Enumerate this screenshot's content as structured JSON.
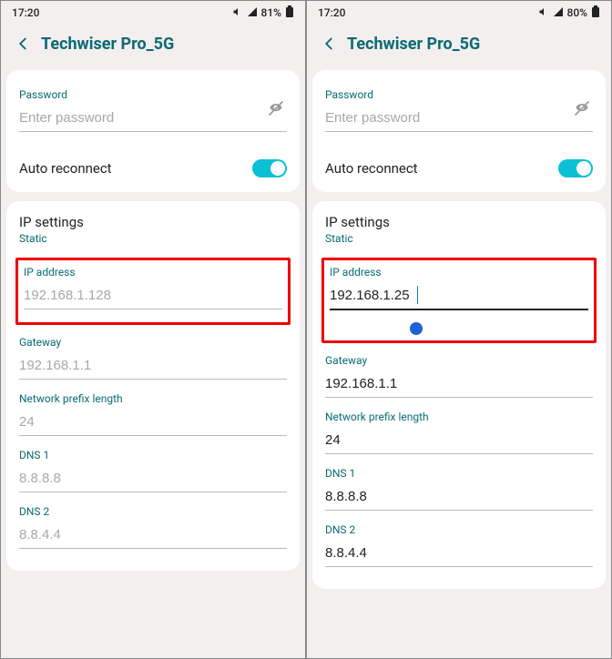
{
  "left": {
    "status": {
      "time": "17:20",
      "battery": "81%"
    },
    "title": "Techwiser Pro_5G",
    "password": {
      "label": "Password",
      "placeholder": "Enter password"
    },
    "autoReconnect": {
      "label": "Auto reconnect",
      "enabled": true
    },
    "ip": {
      "section": "IP settings",
      "mode": "Static",
      "ipAddress": {
        "label": "IP address",
        "value": "192.168.1.128",
        "filled": false
      },
      "gateway": {
        "label": "Gateway",
        "value": "192.168.1.1",
        "filled": false
      },
      "prefix": {
        "label": "Network prefix length",
        "value": "24",
        "filled": false
      },
      "dns1": {
        "label": "DNS 1",
        "value": "8.8.8.8",
        "filled": false
      },
      "dns2": {
        "label": "DNS 2",
        "value": "8.8.4.4",
        "filled": false
      }
    }
  },
  "right": {
    "status": {
      "time": "17:20",
      "battery": "80%"
    },
    "title": "Techwiser Pro_5G",
    "password": {
      "label": "Password",
      "placeholder": "Enter password"
    },
    "autoReconnect": {
      "label": "Auto reconnect",
      "enabled": true
    },
    "ip": {
      "section": "IP settings",
      "mode": "Static",
      "ipAddress": {
        "label": "IP address",
        "value": "192.168.1.25",
        "filled": true
      },
      "gateway": {
        "label": "Gateway",
        "value": "192.168.1.1",
        "filled": true
      },
      "prefix": {
        "label": "Network prefix length",
        "value": "24",
        "filled": true
      },
      "dns1": {
        "label": "DNS 1",
        "value": "8.8.8.8",
        "filled": true
      },
      "dns2": {
        "label": "DNS 2",
        "value": "8.8.4.4",
        "filled": true
      }
    }
  }
}
